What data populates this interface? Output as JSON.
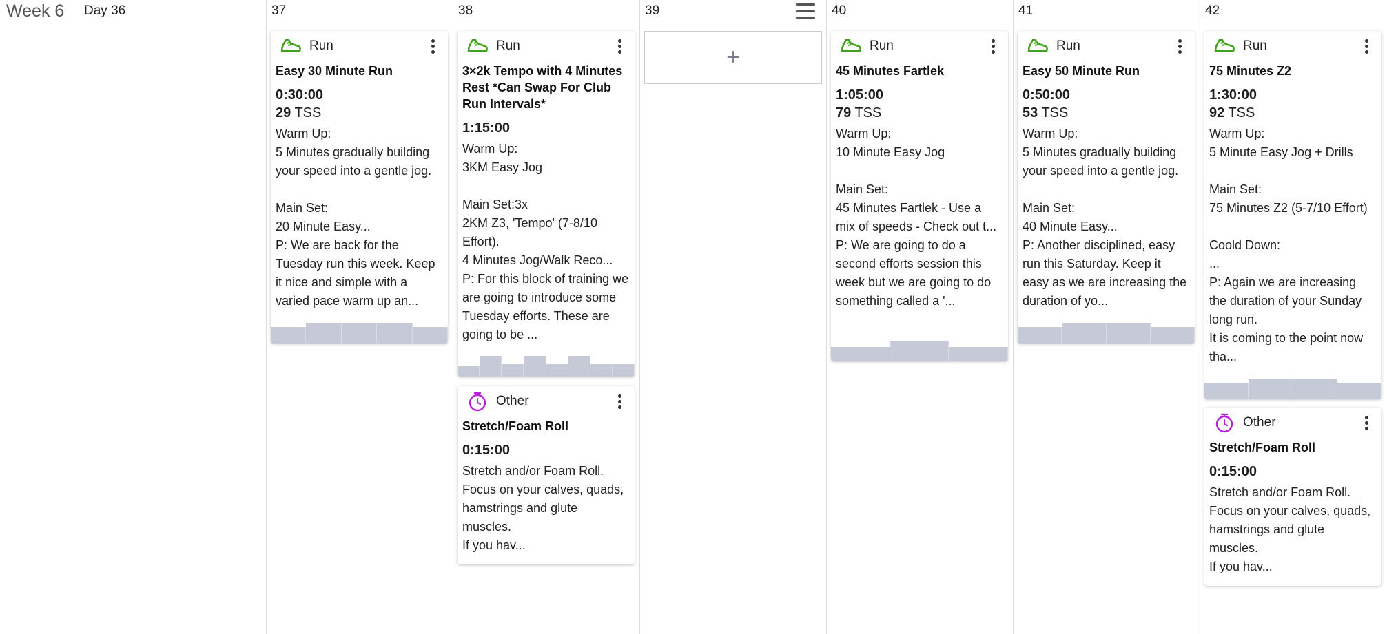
{
  "week": {
    "label": "Week 6"
  },
  "days": [
    {
      "num": "Day 36"
    },
    {
      "num": "37"
    },
    {
      "num": "38"
    },
    {
      "num": "39"
    },
    {
      "num": "40"
    },
    {
      "num": "41"
    },
    {
      "num": "42"
    }
  ],
  "day39": {
    "add_label": "+"
  },
  "colors": {
    "run": "#3ea31b",
    "other": "#b623d6",
    "profile": "#c5cad6"
  },
  "workouts": [
    {
      "type": "Run",
      "icon": "running-shoe-icon",
      "title": "Easy 30 Minute Run",
      "duration": "0:30:00",
      "tss_value": "29",
      "tss_unit": "TSS",
      "description": "Warm Up:\n5 Minutes gradually building your speed into a gentle jog.\n\nMain Set:\n20 Minute Easy...\nP: We are back for the Tuesday run this week. Keep it nice and simple with a varied pace warm up an...",
      "profile": [
        0.8,
        1.0,
        1.0,
        1.0,
        0.8
      ]
    },
    {
      "type": "Run",
      "icon": "running-shoe-icon",
      "title": "3×2k Tempo with 4 Minutes Rest *Can Swap For Club Run Intervals*",
      "duration": "1:15:00",
      "tss_value": "",
      "tss_unit": "",
      "description": "Warm Up:\n3KM Easy Jog\n\nMain Set:3x\n2KM Z3, 'Tempo' (7-8/10 Effort).\n4 Minutes Jog/Walk Reco...\nP: For this block of training we are going to introduce some Tuesday efforts. These are going to be ...",
      "profile": [
        0.5,
        1.0,
        0.6,
        1.0,
        0.6,
        1.0,
        0.6,
        0.6
      ]
    },
    {
      "type": "Other",
      "icon": "stopwatch-icon",
      "title": "Stretch/Foam Roll",
      "duration": "0:15:00",
      "tss_value": "",
      "tss_unit": "",
      "description": "Stretch and/or Foam Roll. Focus on your calves, quads, hamstrings and glute muscles.\nIf you hav...",
      "profile": []
    },
    {
      "type": "Run",
      "icon": "running-shoe-icon",
      "title": "45 Minutes Fartlek",
      "duration": "1:05:00",
      "tss_value": "79",
      "tss_unit": "TSS",
      "description": "Warm Up:\n10 Minute Easy Jog\n\nMain Set:\n45 Minutes Fartlek - Use a mix of speeds - Check out t...\nP: We are going to do a second efforts session this week but we are going to do something called a '...",
      "profile": [
        0.7,
        1.0,
        0.7
      ]
    },
    {
      "type": "Run",
      "icon": "running-shoe-icon",
      "title": "Easy 50 Minute Run",
      "duration": "0:50:00",
      "tss_value": "53",
      "tss_unit": "TSS",
      "description": "Warm Up:\n5 Minutes gradually building your speed into a gentle jog.\n\nMain Set:\n40 Minute Easy...\nP: Another disciplined, easy run this Saturday. Keep it easy as we are increasing the duration of yo...",
      "profile": [
        0.8,
        1.0,
        1.0,
        0.8
      ]
    },
    {
      "type": "Run",
      "icon": "running-shoe-icon",
      "title": "75 Minutes Z2",
      "duration": "1:30:00",
      "tss_value": "92",
      "tss_unit": "TSS",
      "description": "Warm Up:\n5 Minute Easy Jog + Drills\n\nMain Set:\n75 Minutes Z2 (5-7/10 Effort)\n\nCoold Down:\n...\nP: Again we are increasing the duration of your Sunday long run.\nIt is coming to the point now tha...",
      "profile": [
        0.8,
        1.0,
        1.0,
        0.8
      ]
    },
    {
      "type": "Other",
      "icon": "stopwatch-icon",
      "title": "Stretch/Foam Roll",
      "duration": "0:15:00",
      "tss_value": "",
      "tss_unit": "",
      "description": "Stretch and/or Foam Roll. Focus on your calves, quads, hamstrings and glute muscles.\nIf you hav...",
      "profile": []
    }
  ]
}
